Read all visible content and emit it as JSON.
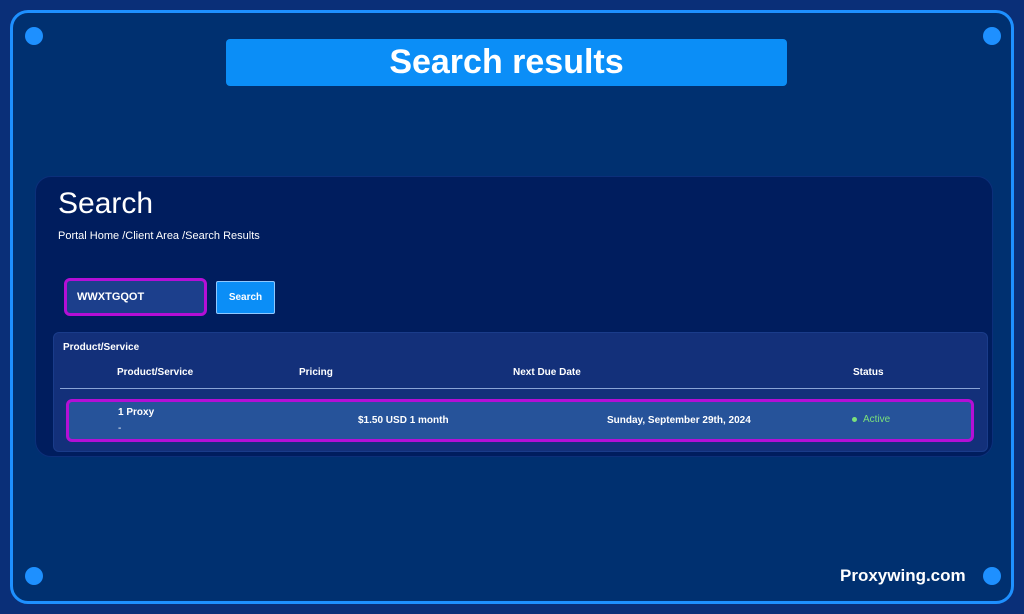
{
  "banner": {
    "title": "Search results"
  },
  "panel": {
    "title": "Search",
    "breadcrumb": "Portal Home /Client Area /Search Results"
  },
  "search": {
    "value": "WWXTGQOT",
    "button_label": "Search"
  },
  "results": {
    "caption": "Product/Service",
    "columns": [
      "Product/Service",
      "Pricing",
      "Next Due Date",
      "Status"
    ],
    "rows": [
      {
        "product": "1 Proxy",
        "product_sub": "-",
        "pricing": "$1.50 USD 1 month",
        "next_due": "Sunday, September 29th, 2024",
        "status": "Active"
      }
    ]
  },
  "footer": {
    "brand": "Proxywing.com"
  },
  "colors": {
    "accent": "#0b8ef7",
    "highlight": "#b40fd6",
    "status_active": "#7be07b"
  }
}
